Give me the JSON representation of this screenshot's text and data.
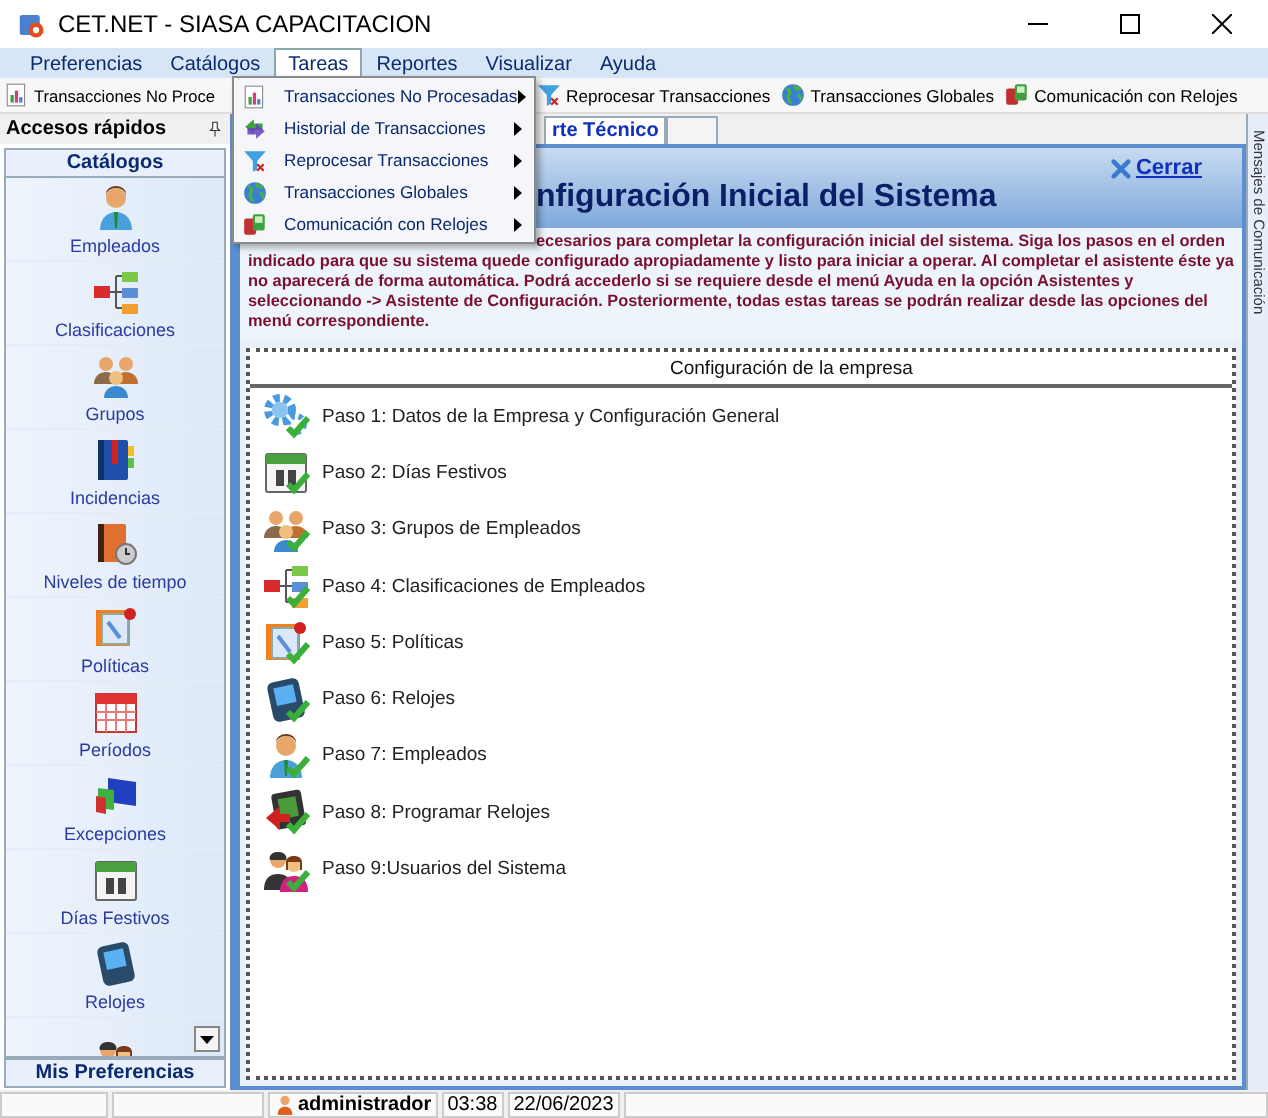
{
  "window": {
    "title": "CET.NET - SIASA CAPACITACION"
  },
  "menu_bar": [
    {
      "label": "Preferencias",
      "selected": false
    },
    {
      "label": "Catálogos",
      "selected": false
    },
    {
      "label": "Tareas",
      "selected": true
    },
    {
      "label": "Reportes",
      "selected": false
    },
    {
      "label": "Visualizar",
      "selected": false
    },
    {
      "label": "Ayuda",
      "selected": false
    }
  ],
  "dropdown_menu": [
    {
      "label": "Transacciones No Procesadas",
      "kind": "transactions",
      "has_submenu": true
    },
    {
      "label": "Historial de Transacciones",
      "kind": "history",
      "has_submenu": true
    },
    {
      "label": "Reprocesar Transacciones",
      "kind": "funnel",
      "has_submenu": true
    },
    {
      "label": "Transacciones Globales",
      "kind": "globe",
      "has_submenu": true
    },
    {
      "label": "Comunicación con Relojes",
      "kind": "clockcomm",
      "has_submenu": true
    }
  ],
  "toolbar": [
    {
      "label": "Transacciones No Proce",
      "kind": "transactions"
    },
    {
      "label": "Reprocesar Transacciones",
      "kind": "funnel"
    },
    {
      "label": "Transacciones Globales",
      "kind": "globe"
    },
    {
      "label": "Comunicación con Relojes",
      "kind": "clockcomm"
    }
  ],
  "sidebar": {
    "title": "Accesos rápidos",
    "section": "Catálogos",
    "footer": "Mis Preferencias",
    "items": [
      {
        "label": "Empleados",
        "kind": "person"
      },
      {
        "label": "Clasificaciones",
        "kind": "diagram"
      },
      {
        "label": "Grupos",
        "kind": "group"
      },
      {
        "label": "Incidencias",
        "kind": "book"
      },
      {
        "label": "Niveles de tiempo",
        "kind": "notebook"
      },
      {
        "label": "Políticas",
        "kind": "document"
      },
      {
        "label": "Períodos",
        "kind": "calendar"
      },
      {
        "label": "Excepciones",
        "kind": "flags"
      },
      {
        "label": "Días Festivos",
        "kind": "holiday"
      },
      {
        "label": "Relojes",
        "kind": "device"
      },
      {
        "kind": "users"
      }
    ]
  },
  "tabs": [
    {
      "label": "rte Técnico",
      "selected": true
    }
  ],
  "header": {
    "title": "nfiguración Inicial del Sistema",
    "close_link": "Cerrar"
  },
  "description": "ecesarios para completar la configuración inicial del sistema. Siga los pasos en el orden indicado para que su sistema quede configurado apropiadamente y listo para iniciar a operar. Al completar el asistente éste ya no aparecerá de forma automática. Podrá accederlo si se requiere desde el menú Ayuda en la opción Asistentes y seleccionando -> Asistente de Configuración. Posteriormente, todas estas tareas se podrán realizar desde las opciones del menú correspondiente.",
  "steps_panel": {
    "title": "Configuración de la empresa",
    "steps": [
      {
        "label": "Paso 1: Datos de la Empresa y Configuración General",
        "kind": "gear"
      },
      {
        "label": "Paso 2: Días Festivos",
        "kind": "holiday"
      },
      {
        "label": "Paso 3: Grupos de Empleados",
        "kind": "group"
      },
      {
        "label": "Paso 4: Clasificaciones de Empleados",
        "kind": "diagram"
      },
      {
        "label": "Paso 5: Políticas",
        "kind": "document"
      },
      {
        "label": "Paso 6: Relojes",
        "kind": "device"
      },
      {
        "label": "Paso 7: Empleados",
        "kind": "person"
      },
      {
        "label": "Paso 8: Programar Relojes",
        "kind": "program"
      },
      {
        "label": "Paso 9:Usuarios del Sistema",
        "kind": "users"
      }
    ]
  },
  "side_strip": {
    "label": "Mensajes de Comunicación"
  },
  "status_bar": {
    "user": "administrador",
    "time": "03:38",
    "date": "22/06/2023"
  }
}
